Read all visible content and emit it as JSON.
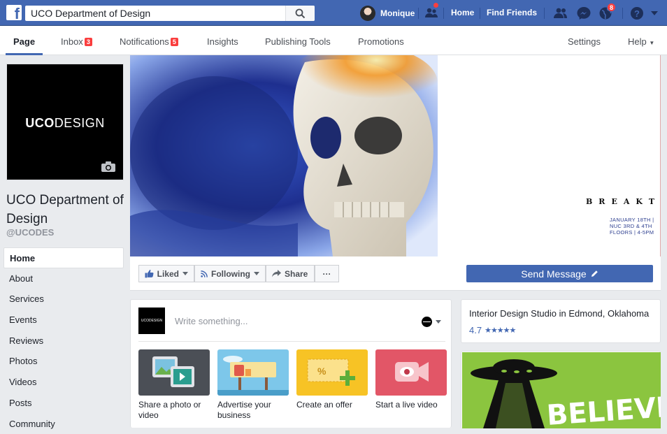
{
  "topbar": {
    "search_value": "UCO Department of Design",
    "user_name": "Monique",
    "home_label": "Home",
    "find_friends_label": "Find Friends",
    "notifications_count": "8"
  },
  "tabs": {
    "page": "Page",
    "inbox": "Inbox",
    "inbox_count": "3",
    "notifications": "Notifications",
    "notifications_count": "5",
    "insights": "Insights",
    "publishing_tools": "Publishing Tools",
    "promotions": "Promotions",
    "settings": "Settings",
    "help": "Help"
  },
  "profile": {
    "logo_bold": "UCO",
    "logo_light": "DESIGN",
    "name": "UCO Department of Design",
    "handle": "@UCODES"
  },
  "left_nav": [
    "Home",
    "About",
    "Services",
    "Events",
    "Reviews",
    "Photos",
    "Videos",
    "Posts",
    "Community"
  ],
  "cover": {
    "title": "BREAKTHROUGH!",
    "subtitle": "JANUARY 18TH  |  NUC 3RD & 4TH FLOORS  |  4-5PM"
  },
  "actions": {
    "liked": "Liked",
    "following": "Following",
    "share": "Share",
    "more": "···",
    "send_message": "Send Message"
  },
  "composer": {
    "mini_logo": "UCODESIGN",
    "placeholder": "Write something...",
    "cards": [
      {
        "label": "Share a photo or video"
      },
      {
        "label": "Advertise your business"
      },
      {
        "label": "Create an offer"
      },
      {
        "label": "Start a live video"
      }
    ]
  },
  "rating": {
    "title": "Interior Design Studio in Edmond, Oklahoma",
    "value": "4.7",
    "stars": "★★★★★"
  },
  "ad": {
    "text": "BELIEVE"
  },
  "colors": {
    "brand": "#4267b2",
    "badge": "#fa3e3e",
    "ad_green": "#8bc53f"
  }
}
